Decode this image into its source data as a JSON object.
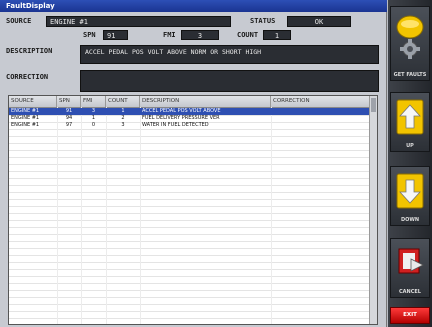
{
  "window": {
    "title": "FaultDisplay"
  },
  "fields": {
    "source_label": "SOURCE",
    "source_value": "ENGINE #1",
    "status_label": "STATUS",
    "status_value": "OK",
    "spn_label": "SPN",
    "spn_value": "91",
    "fmi_label": "FMI",
    "fmi_value": "3",
    "count_label": "COUNT",
    "count_value": "1",
    "description_label": "DESCRIPTION",
    "description_value": "ACCEL PEDAL POS VOLT ABOVE NORM OR SHORT HIGH",
    "correction_label": "CORRECTION",
    "correction_value": ""
  },
  "table": {
    "columns": [
      "SOURCE",
      "SPN",
      "FMI",
      "COUNT",
      "DESCRIPTION",
      "CORRECTION"
    ],
    "rows": [
      [
        "ENGINE #1",
        "91",
        "3",
        "1",
        "ACCEL PEDAL POS VOLT ABOVE",
        ""
      ],
      [
        "ENGINE #1",
        "94",
        "1",
        "2",
        "FUEL DELIVERY PRESSURE VER",
        ""
      ],
      [
        "ENGINE #1",
        "97",
        "0",
        "3",
        "WATER IN FUEL DETECTED",
        ""
      ]
    ],
    "selected_row": 0
  },
  "toolbar": {
    "get_faults": "GET FAULTS",
    "up": "UP",
    "down": "DOWN",
    "cancel": "CANCEL",
    "exit": "EXIT"
  },
  "icons": {
    "get_faults": "gear-icon",
    "up": "arrow-up-icon",
    "down": "arrow-down-icon",
    "cancel": "cancel-icon"
  },
  "colors": {
    "title_bar": "#1f3c9e",
    "selection": "#2e4fb2",
    "field_bg": "#2a2d33",
    "exit": "#d40000",
    "button_accent": "#f2c400"
  }
}
